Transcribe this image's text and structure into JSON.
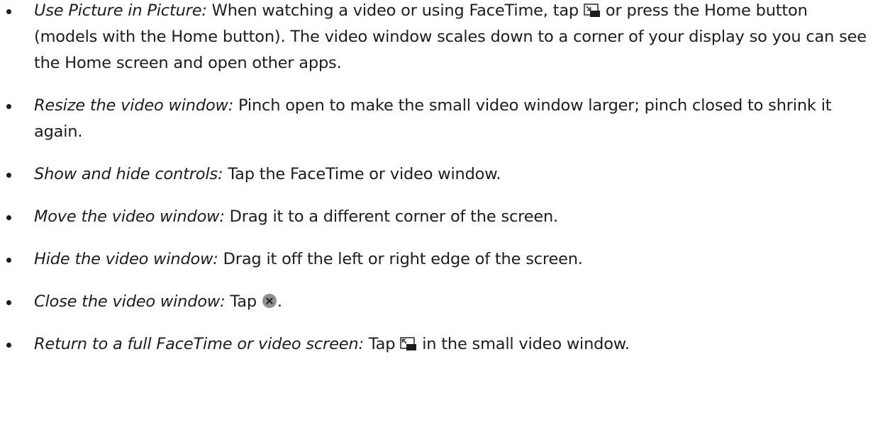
{
  "items": [
    {
      "term": "Use Picture in Picture:",
      "before": " When watching a video or using FaceTime, tap ",
      "icon": "pip-enter-icon",
      "after": " or press the Home button (models with the Home button). The video window scales down to a corner of your display so you can see the Home screen and open other apps."
    },
    {
      "term": "Resize the video window:",
      "text": " Pinch open to make the small video window larger; pinch closed to shrink it again."
    },
    {
      "term": "Show and hide controls:",
      "text": " Tap the FaceTime or video window."
    },
    {
      "term": "Move the video window:",
      "text": " Drag it to a different corner of the screen."
    },
    {
      "term": "Hide the video window:",
      "text": " Drag it off the left or right edge of the screen."
    },
    {
      "term": "Close the video window:",
      "before": " Tap ",
      "icon": "close-circle-icon",
      "after": "."
    },
    {
      "term": "Return to a full FaceTime or video screen:",
      "before": " Tap ",
      "icon": "pip-exit-icon",
      "after": " in the small video window."
    }
  ]
}
